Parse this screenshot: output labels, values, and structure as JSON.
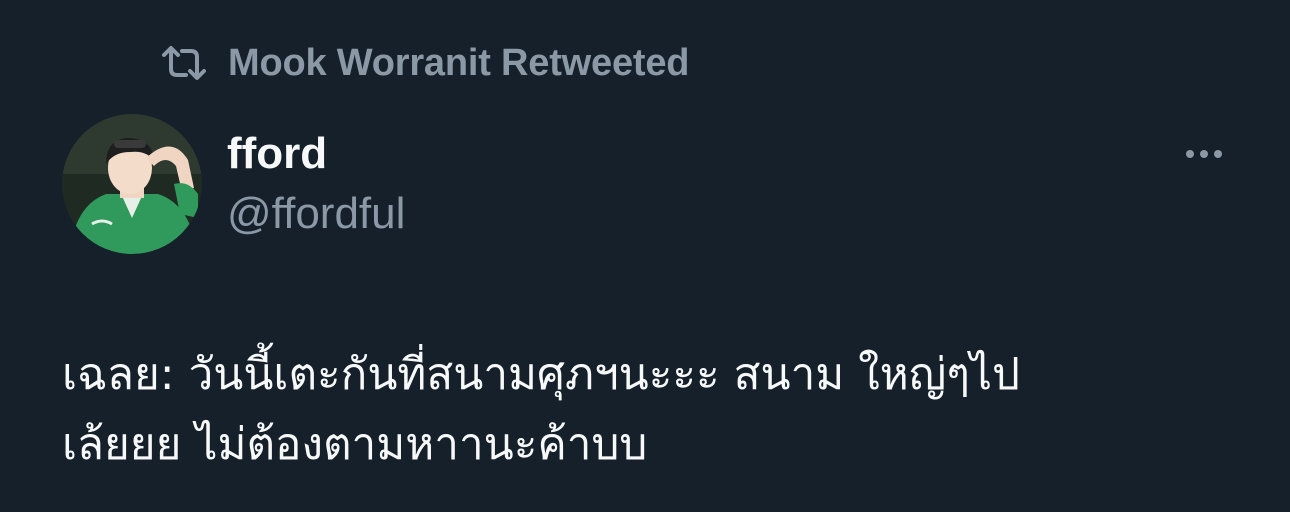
{
  "retweet": {
    "icon": "retweet-icon",
    "text": "Mook Worranit Retweeted"
  },
  "author": {
    "avatar_icon": "avatar",
    "display_name": "fford",
    "handle": "@ffordful"
  },
  "more": {
    "icon": "more-horizontal-icon"
  },
  "tweet": {
    "lines": [
      "เฉลย: วันนี้เตะกันที่สนามศุภฯนะะะ สนาม ใหญ่ๆไป",
      "เล้ยยย ไม่ต้องตามหาานะค้าบบ"
    ]
  },
  "colors": {
    "background": "#15202b",
    "primary_text": "#f7f9f9",
    "secondary_text": "#8b98a5"
  }
}
